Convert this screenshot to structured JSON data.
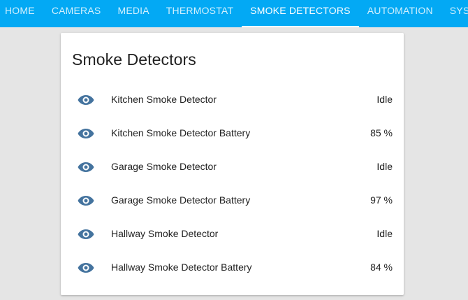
{
  "nav": {
    "tabs": [
      {
        "label": "HOME"
      },
      {
        "label": "CAMERAS"
      },
      {
        "label": "MEDIA"
      },
      {
        "label": "THERMOSTAT"
      },
      {
        "label": "SMOKE DETECTORS"
      },
      {
        "label": "AUTOMATION"
      },
      {
        "label": "SYSTEM"
      }
    ],
    "active_tab": "SMOKE DETECTORS"
  },
  "card": {
    "title": "Smoke Detectors",
    "entities": [
      {
        "icon": "eye-icon",
        "name": "Kitchen Smoke Detector",
        "state": "Idle"
      },
      {
        "icon": "eye-icon",
        "name": "Kitchen Smoke Detector Battery",
        "state": "85 %"
      },
      {
        "icon": "eye-icon",
        "name": "Garage Smoke Detector",
        "state": "Idle"
      },
      {
        "icon": "eye-icon",
        "name": "Garage Smoke Detector Battery",
        "state": "97 %"
      },
      {
        "icon": "eye-icon",
        "name": "Hallway Smoke Detector",
        "state": "Idle"
      },
      {
        "icon": "eye-icon",
        "name": "Hallway Smoke Detector Battery",
        "state": "84 %"
      }
    ]
  },
  "colors": {
    "header": "#03a9f4",
    "background": "#e5e5e5",
    "icon": "#44739e",
    "text": "#212121"
  }
}
